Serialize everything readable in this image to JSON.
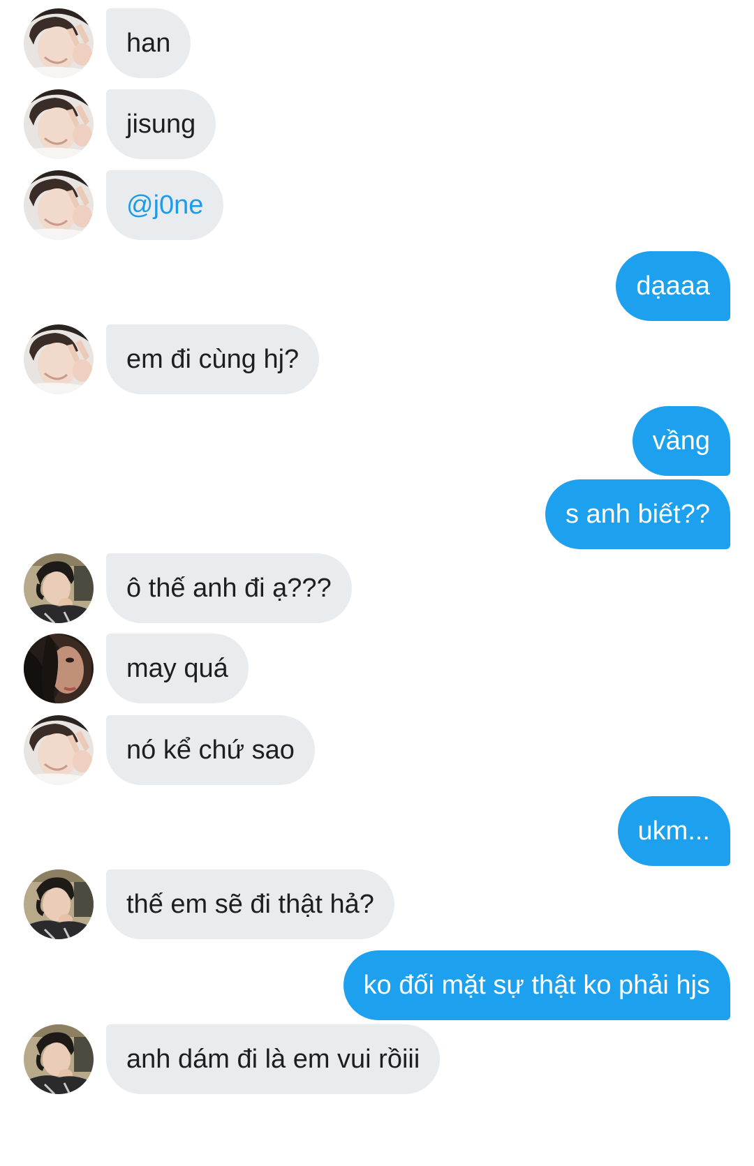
{
  "conversation": {
    "messages": [
      {
        "side": "in",
        "avatar": "han-peace",
        "text": "han"
      },
      {
        "side": "in",
        "avatar": "han-peace",
        "text": "jisung"
      },
      {
        "side": "in",
        "avatar": "han-peace",
        "text": "@j0ne",
        "mention": true
      },
      {
        "side": "out",
        "text": "dạaaa"
      },
      {
        "side": "in",
        "avatar": "han-peace",
        "text": "em đi cùng hj?"
      },
      {
        "side": "out",
        "text": "vầng"
      },
      {
        "side": "out",
        "text": "s anh biết??"
      },
      {
        "side": "in",
        "avatar": "bus-boy",
        "text": "ô thế anh đi ạ???"
      },
      {
        "side": "in",
        "avatar": "dark-face",
        "text": "may quá"
      },
      {
        "side": "in",
        "avatar": "han-peace",
        "text": "nó kể chứ sao"
      },
      {
        "side": "out",
        "text": "ukm..."
      },
      {
        "side": "in",
        "avatar": "bus-boy",
        "text": "thế em sẽ đi thật hả?"
      },
      {
        "side": "out",
        "text": "ko đối mặt sự thật ko phải hjs"
      },
      {
        "side": "in",
        "avatar": "bus-boy",
        "text": "anh dám đi là em vui rồiii"
      }
    ]
  },
  "colors": {
    "incoming_bubble": "#e9ecef",
    "outgoing_bubble": "#1da1ef",
    "mention_text": "#1d9be7"
  }
}
